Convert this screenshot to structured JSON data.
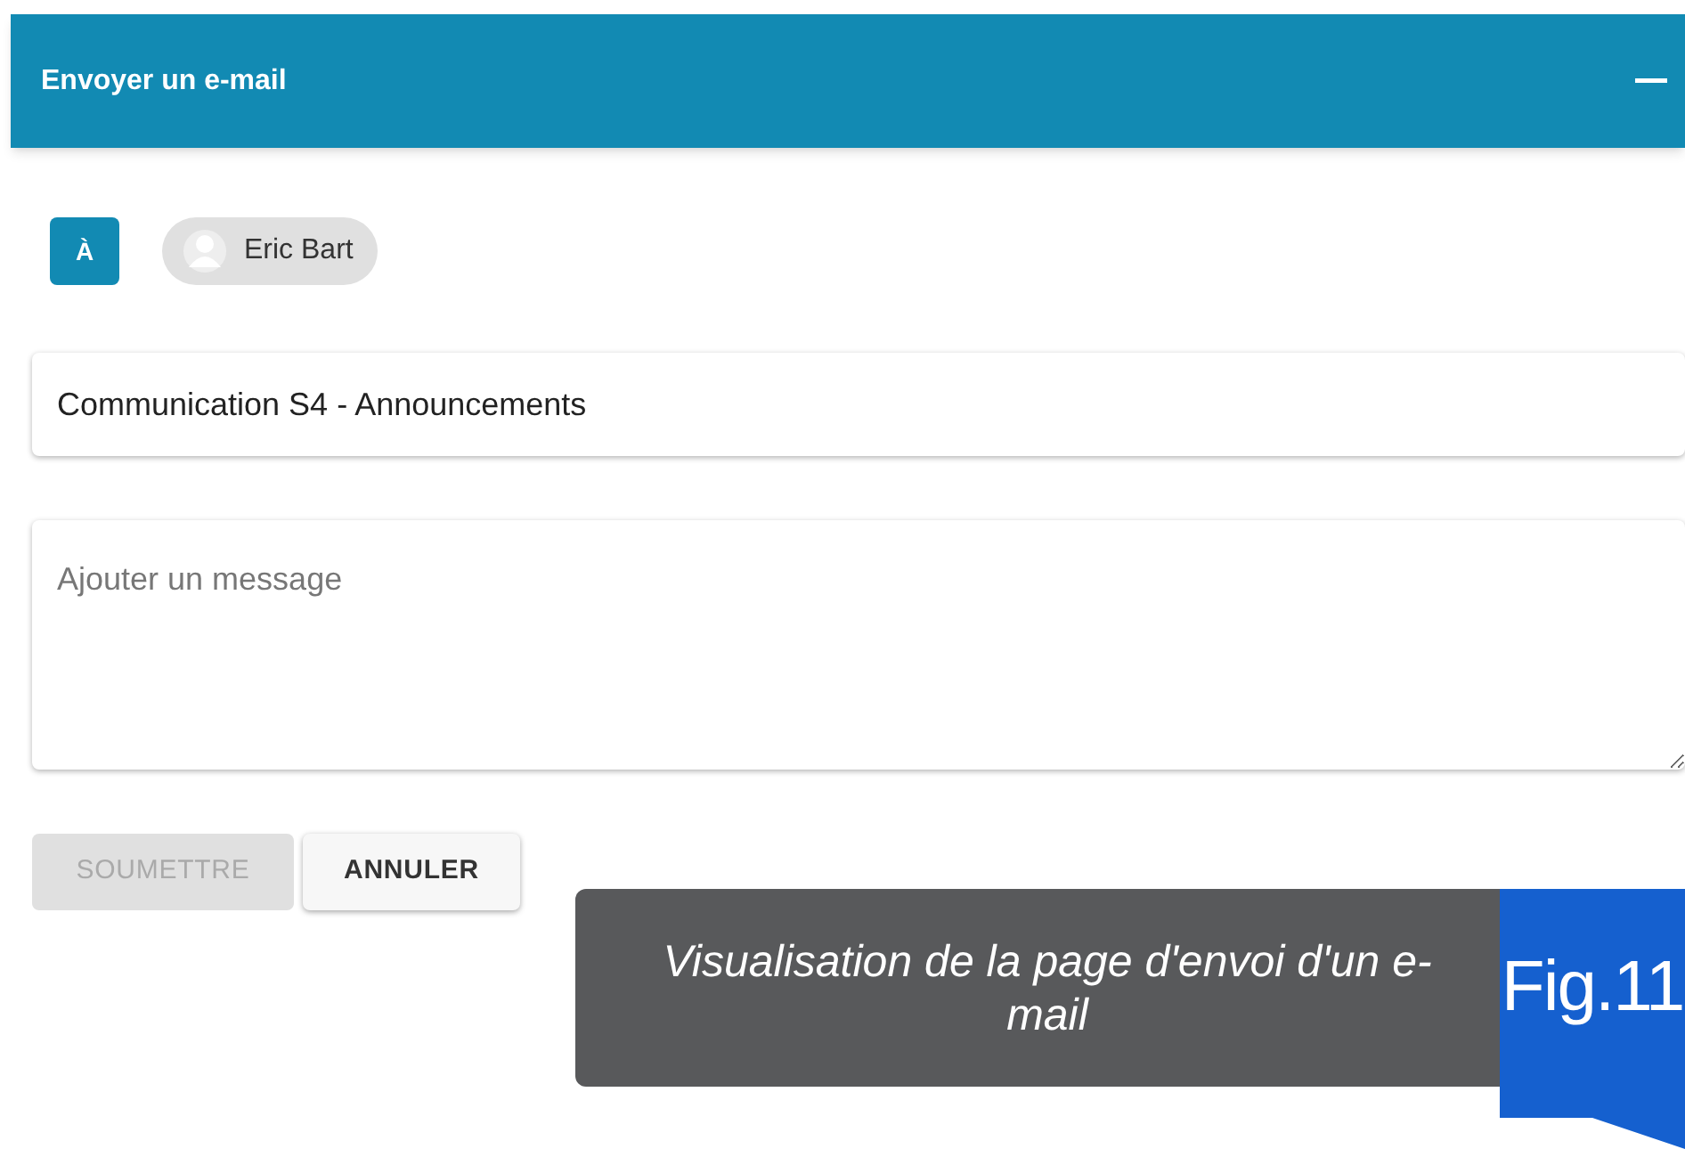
{
  "panel": {
    "title": "Envoyer un e-mail"
  },
  "recipients": {
    "label": "À",
    "chips": [
      {
        "name": "Eric Bart"
      }
    ]
  },
  "subject": {
    "value": "Communication S4 - Announcements"
  },
  "message": {
    "placeholder": "Ajouter un message"
  },
  "buttons": [
    {
      "label": "SOUMETTRE",
      "disabled": true
    },
    {
      "label": "ANNULER",
      "disabled": false
    }
  ],
  "caption": {
    "text": "Visualisation de la page d'envoi d'un e-mail",
    "figure": "Fig.11"
  }
}
